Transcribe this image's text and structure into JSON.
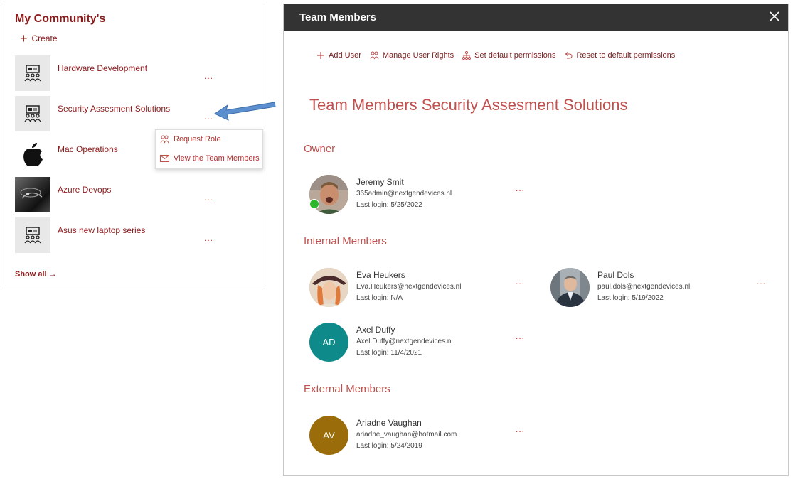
{
  "community": {
    "title": "My Community's",
    "create_label": "Create",
    "items": [
      {
        "name": "Hardware Development",
        "icon": "presentation-icon"
      },
      {
        "name": "Security Assesment Solutions",
        "icon": "presentation-icon"
      },
      {
        "name": "Mac Operations",
        "icon": "apple-icon"
      },
      {
        "name": "Azure Devops",
        "icon": "photo"
      },
      {
        "name": "Asus new laptop series",
        "icon": "presentation-icon"
      }
    ],
    "more_label": "...",
    "show_all_label": "Show all →",
    "context_menu": [
      {
        "label": "Request Role",
        "icon": "people-icon"
      },
      {
        "label": "View the Team Members",
        "icon": "mail-icon"
      }
    ]
  },
  "panel": {
    "title": "Team Members",
    "toolbar": [
      {
        "label": "Add User",
        "icon": "plus-icon"
      },
      {
        "label": "Manage User Rights",
        "icon": "people-icon"
      },
      {
        "label": "Set default permissions",
        "icon": "hierarchy-icon"
      },
      {
        "label": "Reset to default permissions",
        "icon": "undo-icon"
      }
    ],
    "heading": "Team Members Security Assesment Solutions",
    "sections": {
      "owner": "Owner",
      "internal": "Internal Members",
      "external": "External Members"
    },
    "members": {
      "owner": {
        "name": "Jeremy Smit",
        "email": "365admin@nextgendevices.nl",
        "login": "Last login: 5/25/2022"
      },
      "eva": {
        "name": "Eva Heukers",
        "email": "Eva.Heukers@nextgendevices.nl",
        "login": "Last login: N/A"
      },
      "paul": {
        "name": "Paul Dols",
        "email": "paul.dols@nextgendevices.nl",
        "login": "Last login: 5/19/2022"
      },
      "axel": {
        "name": "Axel Duffy",
        "email": "Axel.Duffy@nextgendevices.nl",
        "login": "Last login: 11/4/2021",
        "initials": "AD"
      },
      "ariadne": {
        "name": "Ariadne Vaughan",
        "email": "ariadne_vaughan@hotmail.com",
        "login": "Last login: 5/24/2019",
        "initials": "AV"
      }
    },
    "more_label": "..."
  },
  "colors": {
    "accent": "#8b1a1a",
    "heading": "#c0504d",
    "header_bg": "#333333",
    "teal_avatar": "#0f8a8a",
    "gold_avatar": "#9a6c0a"
  }
}
